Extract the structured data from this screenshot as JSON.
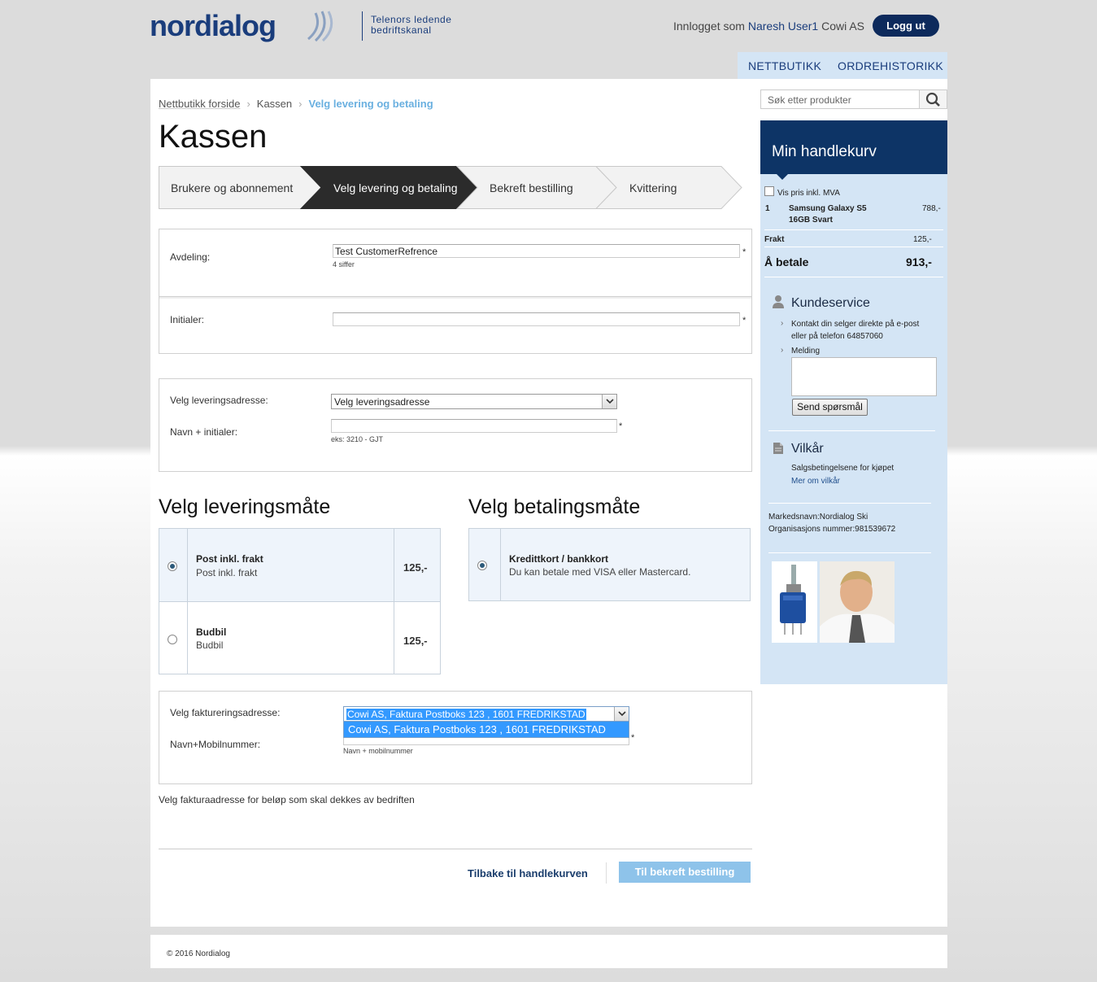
{
  "header": {
    "logo_text": "nordialog",
    "tagline_line1": "Telenors ledende",
    "tagline_line2": "bedriftskanal",
    "login_prefix": "Innlogget som",
    "user_name": "Naresh User1",
    "company": "Cowi AS",
    "logout_label": "Logg ut"
  },
  "nav": {
    "shop": "NETTBUTIKK",
    "orders": "ORDREHISTORIKK"
  },
  "breadcrumb": {
    "home": "Nettbutikk forside",
    "checkout": "Kassen",
    "current": "Velg levering og betaling"
  },
  "page_title": "Kassen",
  "steps": [
    {
      "label": "Brukere og abonnement",
      "active": false
    },
    {
      "label": "Velg levering og betaling",
      "active": true
    },
    {
      "label": "Bekreft bestilling",
      "active": false
    },
    {
      "label": "Kvittering",
      "active": false
    }
  ],
  "form": {
    "department_label": "Avdeling:",
    "department_value": "Test CustomerRefrence",
    "department_hint": "4 siffer",
    "initials_label": "Initialer:",
    "initials_value": "",
    "delivery_address_label": "Velg leveringsadresse:",
    "delivery_address_value": "Velg leveringsadresse",
    "name_initials_label": "Navn + initialer:",
    "name_initials_value": "",
    "name_initials_hint": "eks: 3210 - GJT",
    "required_mark": "*"
  },
  "delivery": {
    "heading": "Velg leveringsmåte",
    "options": [
      {
        "name": "Post inkl. frakt",
        "desc": "Post inkl. frakt",
        "price": "125,-",
        "selected": true
      },
      {
        "name": "Budbil",
        "desc": "Budbil",
        "price": "125,-",
        "selected": false
      }
    ]
  },
  "payment": {
    "heading": "Velg betalingsmåte",
    "options": [
      {
        "name": "Kredittkort / bankkort",
        "desc": "Du kan betale med VISA eller Mastercard.",
        "selected": true
      }
    ]
  },
  "billing": {
    "address_label": "Velg faktureringsadresse:",
    "address_value": "Cowi AS, Faktura Postboks 123 , 1601 FREDRIKSTAD",
    "dropdown_option": "Cowi AS, Faktura Postboks 123 , 1601 FREDRIKSTAD",
    "name_mobile_label": "Navn+Mobilnummer:",
    "name_mobile_hint": "Navn + mobilnummer",
    "note": "Velg fakturaadresse for beløp som skal dekkes av bedriften"
  },
  "actions": {
    "back": "Tilbake til handlekurven",
    "next": "Til bekreft bestilling"
  },
  "sidebar": {
    "search_placeholder": "Søk etter produkter",
    "cart_title": "Min handlekurv",
    "vat_checkbox_label": "Vis pris inkl. MVA",
    "cart_items": [
      {
        "qty": "1",
        "name_line1": "Samsung Galaxy S5",
        "name_line2": "16GB Svart",
        "price": "788,-"
      }
    ],
    "shipping_label": "Frakt",
    "shipping_price": "125,-",
    "total_label": "Å betale",
    "total_price": "913,-",
    "service_heading": "Kundeservice",
    "service_text_line1": "Kontakt din selger direkte på e-post",
    "service_text_line2": "eller på telefon 64857060",
    "message_label": "Melding",
    "send_label": "Send spørsmål",
    "terms_heading": "Vilkår",
    "terms_text": "Salgsbetingelsene for kjøpet",
    "terms_link": "Mer om vilkår",
    "market_name": "Markedsnavn:Nordialog Ski",
    "org_number": "Organisasjons nummer:981539672"
  },
  "footer": {
    "copyright": "© 2016 Nordialog"
  },
  "colors": {
    "brand_navy": "#0d3466",
    "sidebar_bg": "#d4e5f5",
    "active_step": "#2b2b2b",
    "next_button": "#8ec3ea"
  }
}
